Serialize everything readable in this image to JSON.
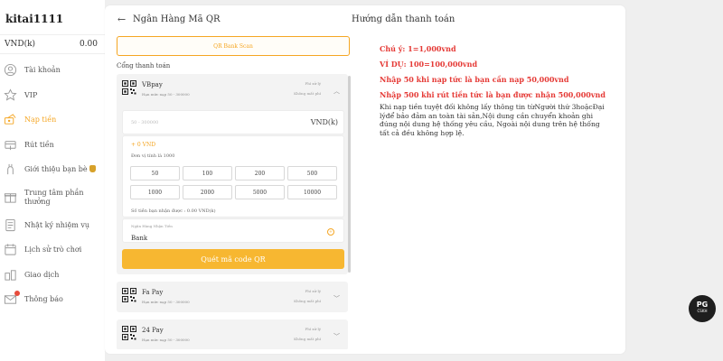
{
  "sidebar": {
    "username": "kitai1111",
    "currency": "VND(k)",
    "balance": "0.00",
    "items": [
      {
        "label": "Tài khoản",
        "icon": "account-icon"
      },
      {
        "label": "VIP",
        "icon": "vip-icon"
      },
      {
        "label": "Nạp tiền",
        "icon": "deposit-icon",
        "active": true
      },
      {
        "label": "Rút tiền",
        "icon": "withdraw-icon"
      },
      {
        "label": "Giới thiệu bạn bè",
        "icon": "referral-icon"
      },
      {
        "label_line1": "Trung tâm phần",
        "label_line2": "thưởng",
        "icon": "reward-icon"
      },
      {
        "label": "Nhật ký nhiệm vụ",
        "icon": "mission-log-icon"
      },
      {
        "label": "Lịch sử trò chơi",
        "icon": "game-history-icon"
      },
      {
        "label": "Giao dịch",
        "icon": "transaction-icon"
      },
      {
        "label": "Thông báo",
        "icon": "notification-icon"
      }
    ]
  },
  "header": {
    "back_symbol": "←",
    "title": "Ngân Hàng Mã QR"
  },
  "qr_tab": "QR Bank Scan",
  "gateway_label": "Cổng thanh toán",
  "gateways": [
    {
      "name": "VBpay",
      "limit": "Hạn mức nạp 50 - 300000",
      "fee_line1": "Phí xử lý",
      "fee_line2": "Không mất phí",
      "expanded": true,
      "amount_placeholder": "50 - 300000",
      "amount_unit": "VND(k)",
      "bonus": "+ 0 VND",
      "unit_note": "Đơn vị tính là 1000",
      "quick_amounts": [
        "50",
        "100",
        "200",
        "500",
        "1000",
        "2000",
        "5000",
        "10000"
      ],
      "receive_note": "Số tiền bạn nhận được : 0.00 VND(k)",
      "bank_label": "Ngân Hàng Nhận Tiền",
      "bank_value": "Bank",
      "scan_button": "Quét mã code QR"
    },
    {
      "name": "Fa Pay",
      "limit": "Hạn mức nạp 50 - 300000",
      "fee_line1": "Phí xử lý",
      "fee_line2": "Không mất phí"
    },
    {
      "name": "24 Pay",
      "limit": "Hạn mức nạp 50 - 300000",
      "fee_line1": "Phí xử lý",
      "fee_line2": "Không mất phí"
    }
  ],
  "guide": {
    "title": "Hướng dẫn thanh toán",
    "lines": [
      "Chú ý:   1=1,000vnd",
      "VÍ DỤ:   100=100,000vnd",
      "Nhập 50 khi nạp tức là bạn cần nạp 50,000vnd",
      "Nhập 500 khi rút tiền tức là bạn được nhận 500,000vnd"
    ],
    "description": "Khi nạp tiền tuyệt đối không lấy thông tin từNgười thứ 3hoặcĐại lýđể bảo đảm an toàn tài sản,Nội dung cần chuyển khoản ghi đúng nội dung hệ thống yêu cầu, Ngoài nội dung trên hệ thống tất cả đều không hợp lệ."
  },
  "support_badge": {
    "logo": "PG",
    "text": "CSKH"
  },
  "colors": {
    "accent": "#f5a623",
    "button": "#f7b731",
    "warning": "#e53935"
  }
}
